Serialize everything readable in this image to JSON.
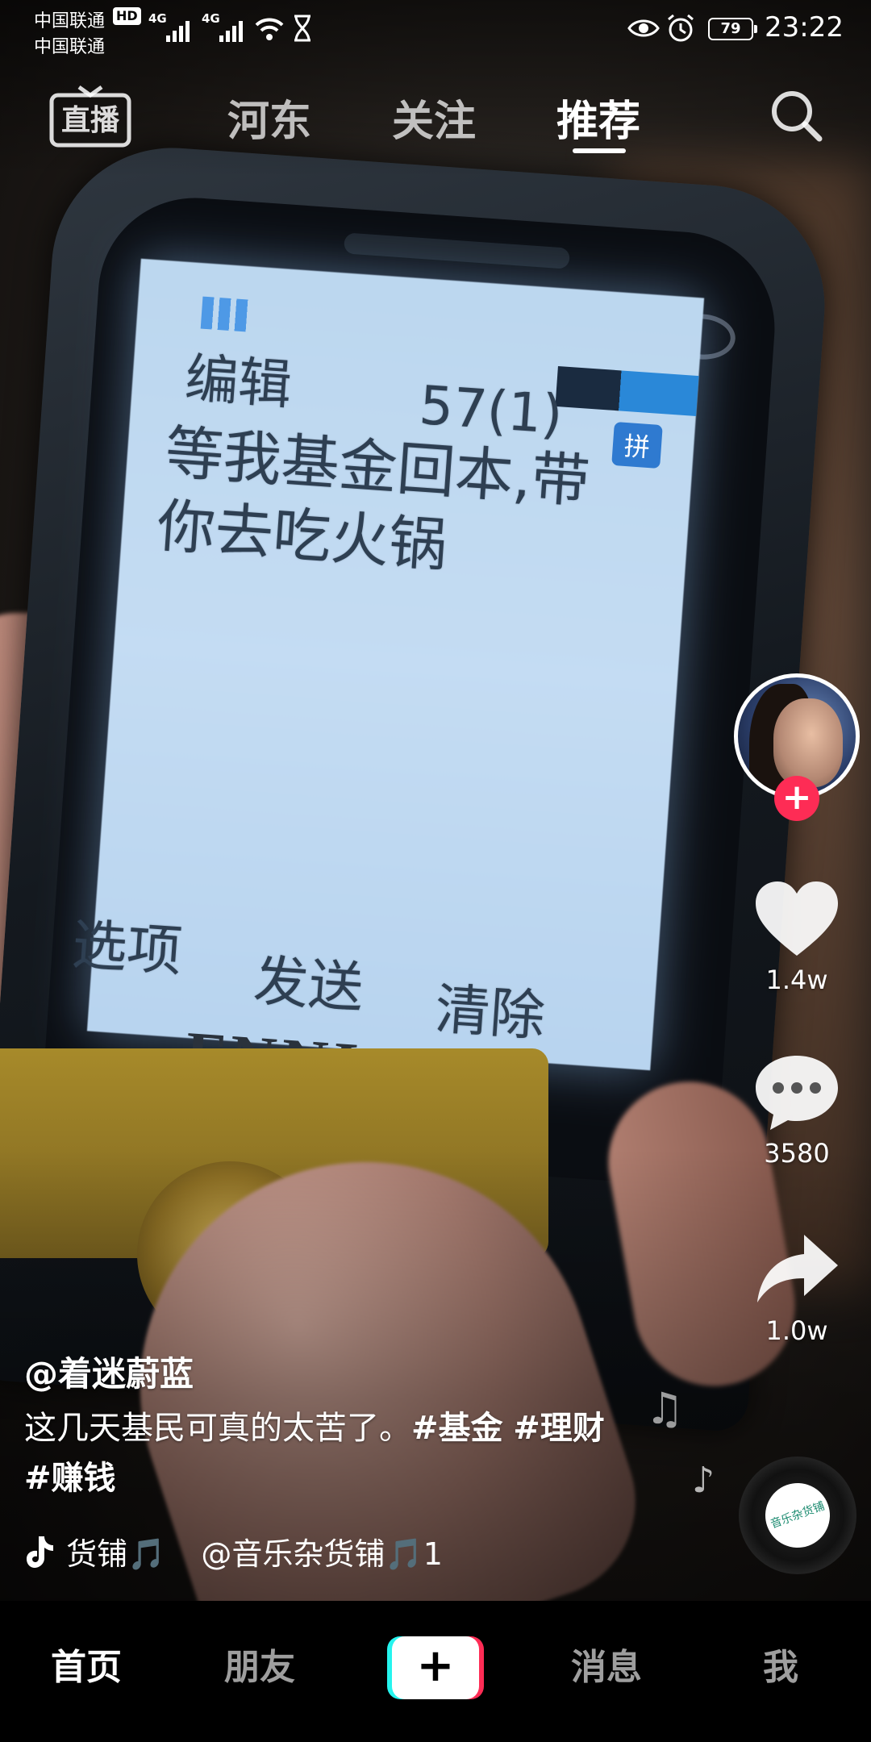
{
  "status_bar": {
    "carrier_1": "中国联通",
    "carrier_2": "中国联通",
    "hd_badge": "HD",
    "net_1": "4G",
    "net_2": "4G",
    "battery": "79",
    "time": "23:22"
  },
  "top_nav": {
    "live_label": "直播",
    "tabs": [
      {
        "label": "河东"
      },
      {
        "label": "关注"
      },
      {
        "label": "推荐"
      }
    ],
    "active_tab": "推荐"
  },
  "video_content": {
    "sms_title": "编辑",
    "sms_counter": "57(1)",
    "sms_input_mode": "拼",
    "sms_line_1": "等我基金回本,带",
    "sms_line_2": "你去吃火锅",
    "soft_key_left": "选项",
    "soft_key_center": "发送",
    "soft_key_right": "清除",
    "phone_brand": "FNNI"
  },
  "actions": {
    "like_count": "1.4w",
    "comment_count": "3580",
    "share_count": "1.0w",
    "follow_plus": "+"
  },
  "post": {
    "author": "@着迷蔚蓝",
    "caption_text": "这几天基民可真的太苦了。",
    "hashtags": [
      "#基金",
      "#理财",
      "#赚钱"
    ],
    "music_segment_1": "货铺🎵",
    "music_segment_2": "@音乐杂货铺🎵1",
    "disc_label": "音乐杂货铺"
  },
  "bottom_tabs": {
    "home": "首页",
    "friends": "朋友",
    "create": "+",
    "messages": "消息",
    "me": "我",
    "active": "首页"
  },
  "colors": {
    "accent_pink": "#fe2c55",
    "accent_cyan": "#25f4ee",
    "background": "#000000",
    "text": "#ffffff"
  },
  "icons": [
    "wifi-icon",
    "hourglass-icon",
    "eye-icon",
    "alarm-icon",
    "search-icon",
    "heart-icon",
    "comment-icon",
    "share-icon",
    "tiktok-note-icon",
    "music-note-icon"
  ]
}
